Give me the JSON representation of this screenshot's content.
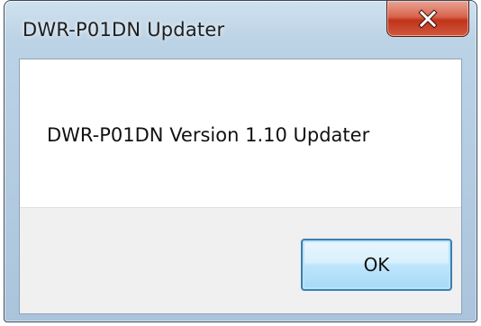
{
  "window": {
    "title": "DWR-P01DN Updater",
    "close_icon": "close-icon"
  },
  "dialog": {
    "message": "DWR-P01DN Version 1.10 Updater",
    "ok_label": "OK"
  },
  "colors": {
    "close_button": "#c0341b",
    "ok_border": "#3c7fb1",
    "button_area": "#f0f0f0",
    "titlebar": "#bcd3e6"
  }
}
